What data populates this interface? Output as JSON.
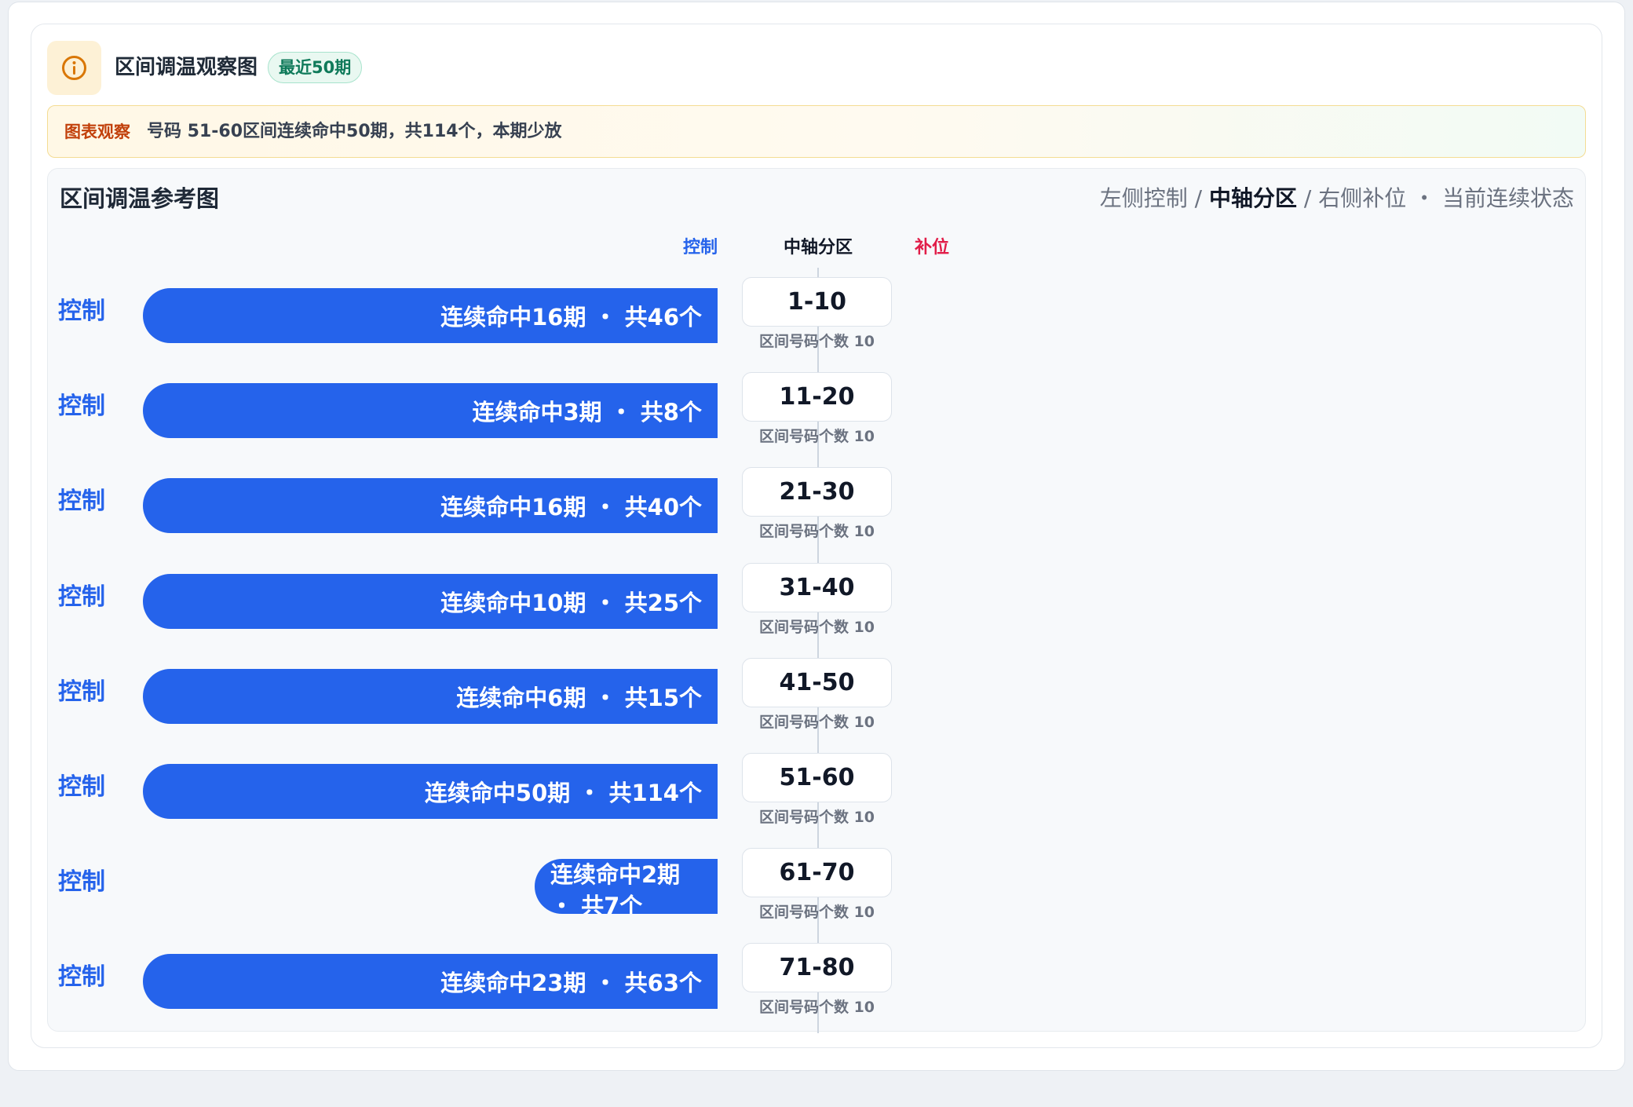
{
  "header": {
    "title": "区间调温观察图",
    "badge": "最近50期"
  },
  "observation": {
    "tag": "图表观察",
    "text": "号码 51-60区间连续命中50期，共114个，本期少放"
  },
  "chart": {
    "title": "区间调温参考图",
    "legend": {
      "left": "左侧控制 / ",
      "center": "中轴分区",
      "right": " / 右侧补位 ・ 当前连续状态"
    },
    "columns": {
      "left": "控制",
      "middle": "中轴分区",
      "right": "补位"
    }
  },
  "colors": {
    "control_blue": "#2563eb",
    "fill_red": "#e11d48",
    "badge_green": "#0f7a5a",
    "observation_orange": "#c2410c"
  },
  "icons": {
    "header": "info-circle-icon"
  },
  "rows": [
    {
      "label": "控制",
      "bar_text": "连续命中16期 ・ 共46个",
      "streak": 16,
      "total": 46,
      "range": "1-10",
      "count_text": "区间号码个数 10"
    },
    {
      "label": "控制",
      "bar_text": "连续命中3期 ・ 共8个",
      "streak": 3,
      "total": 8,
      "range": "11-20",
      "count_text": "区间号码个数 10"
    },
    {
      "label": "控制",
      "bar_text": "连续命中16期 ・ 共40个",
      "streak": 16,
      "total": 40,
      "range": "21-30",
      "count_text": "区间号码个数 10"
    },
    {
      "label": "控制",
      "bar_text": "连续命中10期 ・ 共25个",
      "streak": 10,
      "total": 25,
      "range": "31-40",
      "count_text": "区间号码个数 10"
    },
    {
      "label": "控制",
      "bar_text": "连续命中6期 ・ 共15个",
      "streak": 6,
      "total": 15,
      "range": "41-50",
      "count_text": "区间号码个数 10"
    },
    {
      "label": "控制",
      "bar_text": "连续命中50期 ・ 共114个",
      "streak": 50,
      "total": 114,
      "range": "51-60",
      "count_text": "区间号码个数 10"
    },
    {
      "label": "控制",
      "bar_text": "连续命中2期 ・ 共7个",
      "streak": 2,
      "total": 7,
      "range": "61-70",
      "count_text": "区间号码个数 10"
    },
    {
      "label": "控制",
      "bar_text": "连续命中23期 ・ 共63个",
      "streak": 23,
      "total": 63,
      "range": "71-80",
      "count_text": "区间号码个数 10"
    }
  ]
}
